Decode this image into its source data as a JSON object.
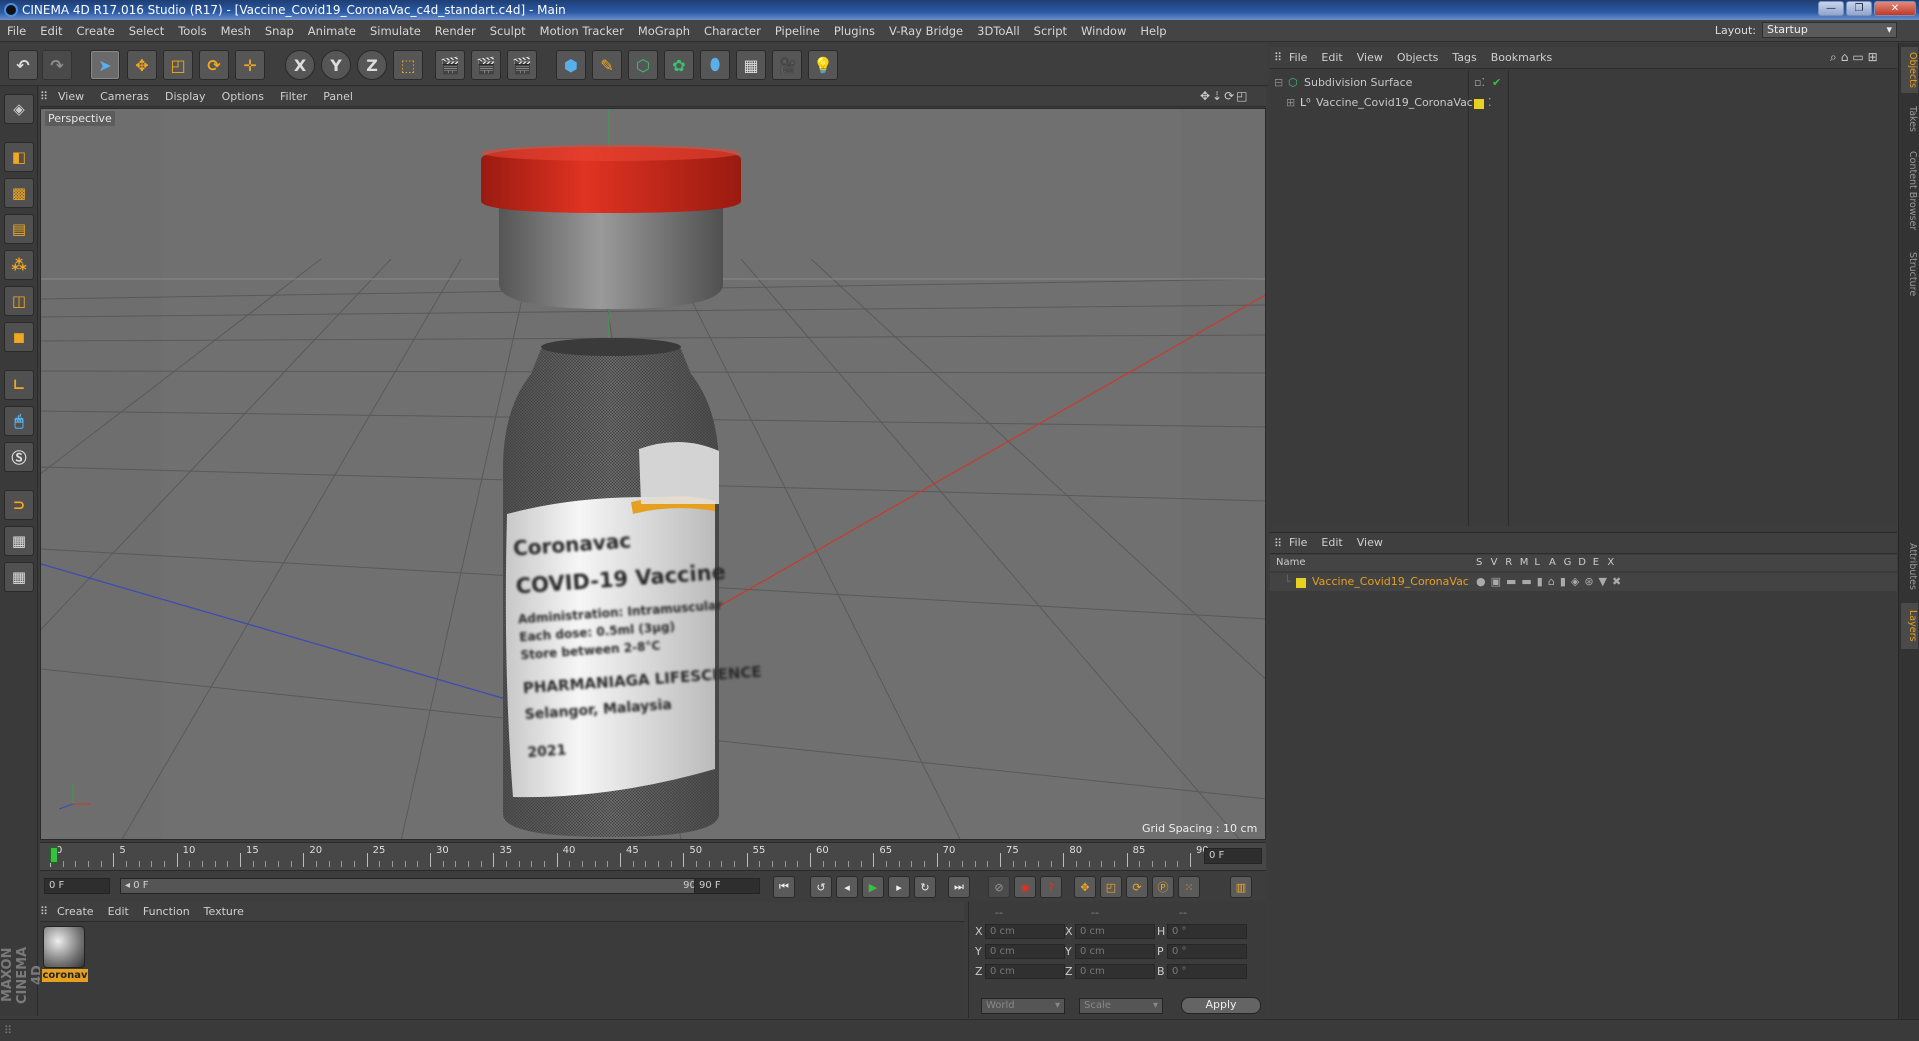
{
  "window": {
    "title": "CINEMA 4D R17.016 Studio (R17) - [Vaccine_Covid19_CoronaVac_c4d_standart.c4d] - Main",
    "minimize": "—",
    "maximize": "❐",
    "close": "✕"
  },
  "menubar": {
    "items": [
      "File",
      "Edit",
      "Create",
      "Select",
      "Tools",
      "Mesh",
      "Snap",
      "Animate",
      "Simulate",
      "Render",
      "Sculpt",
      "Motion Tracker",
      "MoGraph",
      "Character",
      "Pipeline",
      "Plugins",
      "V-Ray Bridge",
      "3DToAll",
      "Script",
      "Window",
      "Help"
    ],
    "layout_label": "Layout:",
    "layout_value": "Startup"
  },
  "toolbar": {
    "axis": [
      "X",
      "Y",
      "Z"
    ]
  },
  "viewport": {
    "menu": [
      "View",
      "Cameras",
      "Display",
      "Options",
      "Filter",
      "Panel"
    ],
    "label": "Perspective",
    "grid_spacing": "Grid Spacing : 10 cm"
  },
  "timeline": {
    "ticks": [
      "0",
      "5",
      "10",
      "15",
      "20",
      "25",
      "30",
      "35",
      "40",
      "45",
      "50",
      "55",
      "60",
      "65",
      "70",
      "75",
      "80",
      "85",
      "90"
    ],
    "end_field": "0 F"
  },
  "transport": {
    "start": "0 F",
    "range_left": "◂ 0 F",
    "range_right": "90 F ▸",
    "end": "90 F"
  },
  "materials": {
    "menu": [
      "Create",
      "Edit",
      "Function",
      "Texture"
    ],
    "material_name": "coronav"
  },
  "coords": {
    "headers": [
      "--",
      "--",
      "--"
    ],
    "rows": [
      {
        "a": "X",
        "av": "0 cm",
        "b": "X",
        "bv": "0 cm",
        "c": "H",
        "cv": "0 °"
      },
      {
        "a": "Y",
        "av": "0 cm",
        "b": "Y",
        "bv": "0 cm",
        "c": "P",
        "cv": "0 °"
      },
      {
        "a": "Z",
        "av": "0 cm",
        "b": "Z",
        "bv": "0 cm",
        "c": "B",
        "cv": "0 °"
      }
    ],
    "world": "World",
    "scale": "Scale",
    "apply": "Apply"
  },
  "objects": {
    "menu": [
      "File",
      "Edit",
      "View",
      "Objects",
      "Tags",
      "Bookmarks"
    ],
    "items": [
      {
        "name": "Subdivision Surface"
      },
      {
        "name": "Vaccine_Covid19_CoronaVac"
      }
    ]
  },
  "layers": {
    "menu": [
      "File",
      "Edit",
      "View"
    ],
    "header_name": "Name",
    "header_cols": [
      "S",
      "V",
      "R",
      "M",
      "L",
      "A",
      "G",
      "D",
      "E",
      "X"
    ],
    "items": [
      {
        "name": "Vaccine_Covid19_CoronaVac"
      }
    ]
  },
  "right_tabs": [
    "Objects",
    "Takes",
    "Content Browser",
    "Structure",
    "Attributes",
    "Layers"
  ],
  "vial_label": {
    "brand": "Coronavac",
    "title": "COVID-19 Vaccine",
    "line1": "Administration: Intramuscular",
    "line2": "Each dose: 0.5ml (3µg)",
    "line3": "Store between 2-8°C",
    "maker": "PHARMANIAGA LIFESCIENCE",
    "city": "Selangor, Malaysia",
    "lot": "2021"
  },
  "branding": {
    "maxon": "MAXON CINEMA 4D"
  },
  "colors": {
    "accent": "#e6a020",
    "cap": "#d42a1a",
    "x_axis": "#c83a2a",
    "z_axis": "#3a4ab8",
    "y_axis": "#3aa040"
  }
}
